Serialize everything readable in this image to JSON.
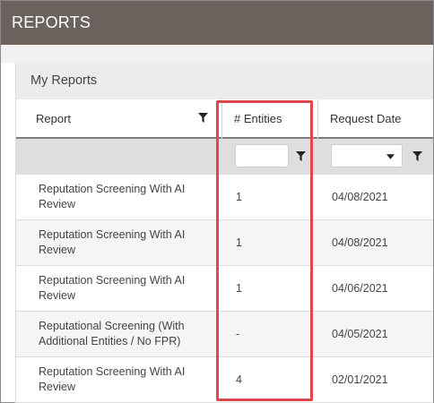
{
  "header": {
    "title": "REPORTS"
  },
  "panel": {
    "title": "My Reports"
  },
  "columns": {
    "report": "Report",
    "entities": "# Entities",
    "request_date": "Request Date"
  },
  "filters": {
    "entities_value": "",
    "request_date_value": ""
  },
  "rows": [
    {
      "report": "Reputation Screening With AI Review",
      "entities": "1",
      "date": "04/08/2021"
    },
    {
      "report": "Reputation Screening With AI Review",
      "entities": "1",
      "date": "04/08/2021"
    },
    {
      "report": "Reputation Screening With AI Review",
      "entities": "1",
      "date": "04/06/2021"
    },
    {
      "report": "Reputational Screening (With Additional Entities / No FPR)",
      "entities": "-",
      "date": "04/05/2021"
    },
    {
      "report": "Reputation Screening With AI Review",
      "entities": "4",
      "date": "02/01/2021"
    }
  ],
  "colors": {
    "topbar": "#6b625e",
    "highlight": "#e0474c"
  },
  "icons": {
    "filter": "funnel-icon",
    "dropdown": "caret-down-icon"
  }
}
